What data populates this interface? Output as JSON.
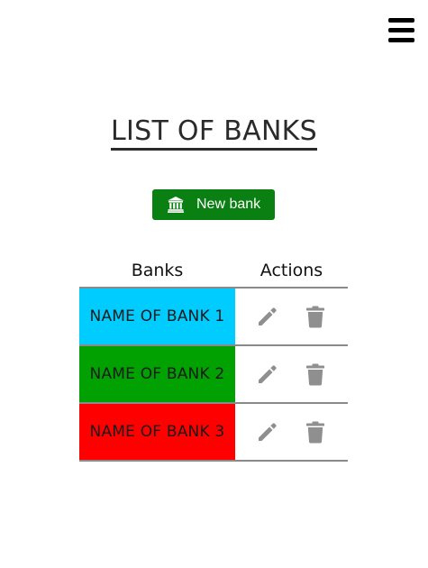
{
  "title": "LIST OF BANKS",
  "new_bank_label": "New bank",
  "table": {
    "headers": {
      "banks": "Banks",
      "actions": "Actions"
    },
    "rows": [
      {
        "name": "NAME OF BANK 1",
        "color": "#00ccff"
      },
      {
        "name": "NAME OF BANK 2",
        "color": "#00a100"
      },
      {
        "name": "NAME OF BANK 3",
        "color": "#ff0000"
      }
    ]
  },
  "colors": {
    "button": "#0a7f12",
    "icon_gray": "#8f8f8f",
    "divider": "#8a8a8a"
  },
  "icons": {
    "menu": "hamburger-icon",
    "bank": "bank-icon",
    "edit": "pencil-icon",
    "delete": "trash-icon"
  }
}
